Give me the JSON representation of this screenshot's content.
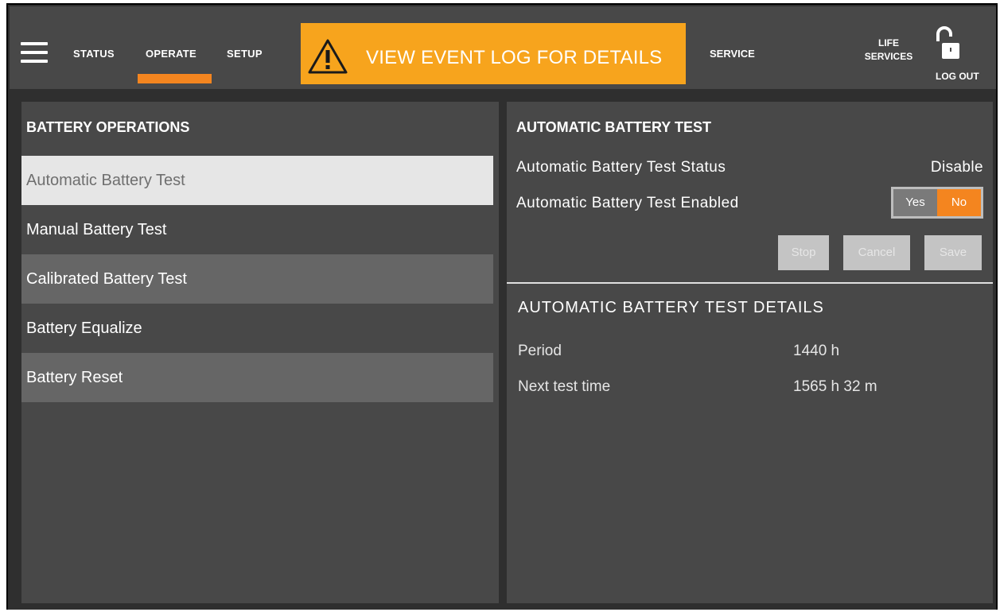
{
  "header": {
    "nav": {
      "status": "STATUS",
      "operate": "OPERATE",
      "setup": "SETUP",
      "service": "SERVICE",
      "life_services": "LIFE SERVICES",
      "logout": "LOG OUT"
    },
    "active_tab": "OPERATE",
    "alert": {
      "text": "VIEW EVENT LOG FOR DETAILS",
      "icon": "warning-icon",
      "color": "#f7a41d"
    },
    "accent_color": "#f4851f"
  },
  "left_panel": {
    "title": "BATTERY OPERATIONS",
    "items": [
      {
        "label": "Automatic Battery Test",
        "selected": true
      },
      {
        "label": "Manual Battery Test",
        "selected": false
      },
      {
        "label": "Calibrated Battery Test",
        "selected": false
      },
      {
        "label": "Battery Equalize",
        "selected": false
      },
      {
        "label": "Battery Reset",
        "selected": false
      }
    ]
  },
  "right_panel": {
    "title": "AUTOMATIC BATTERY TEST",
    "status_label": "Automatic Battery Test Status",
    "status_value": "Disable",
    "enabled_label": "Automatic Battery Test Enabled",
    "toggle": {
      "yes": "Yes",
      "no": "No",
      "selected": "No"
    },
    "buttons": {
      "stop": "Stop",
      "cancel": "Cancel",
      "save": "Save"
    },
    "details": {
      "title": "AUTOMATIC BATTERY TEST DETAILS",
      "period_label": "Period",
      "period_value": "1440 h",
      "next_label": "Next test time",
      "next_value": "1565 h 32 m"
    }
  }
}
